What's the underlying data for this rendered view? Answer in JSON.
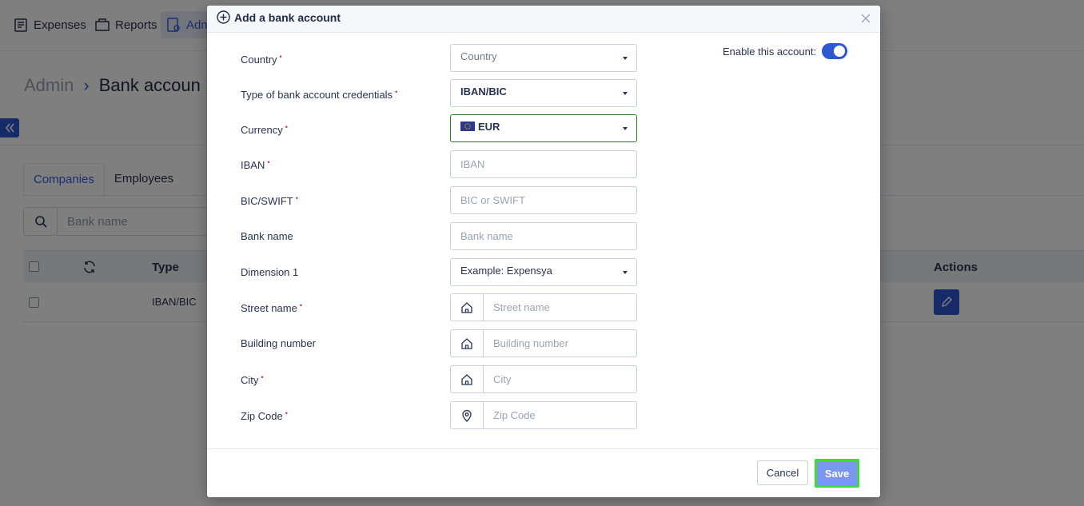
{
  "nav": {
    "expenses": "Expenses",
    "reports": "Reports",
    "admin": "Adm"
  },
  "breadcrumb": {
    "root": "Admin",
    "separator": "›",
    "current": "Bank accoun"
  },
  "tabs": {
    "companies": "Companies",
    "employees": "Employees"
  },
  "search": {
    "placeholder": "Bank name"
  },
  "table": {
    "headers": {
      "type": "Type",
      "actions": "Actions"
    },
    "rows": [
      {
        "type": "IBAN/BIC"
      }
    ]
  },
  "modal": {
    "title": "Add a bank account",
    "enable_label": "Enable this account:",
    "enabled": true,
    "fields": {
      "country": {
        "label": "Country",
        "value": "Country"
      },
      "credentials_type": {
        "label": "Type of bank account credentials",
        "value": "IBAN/BIC"
      },
      "currency": {
        "label": "Currency",
        "value": "EUR"
      },
      "iban": {
        "label": "IBAN",
        "placeholder": "IBAN"
      },
      "bic": {
        "label": "BIC/SWIFT",
        "placeholder": "BIC or SWIFT"
      },
      "bank_name": {
        "label": "Bank name",
        "placeholder": "Bank name"
      },
      "dimension1": {
        "label": "Dimension 1",
        "value": "Example: Expensya"
      },
      "street": {
        "label": "Street name",
        "placeholder": "Street name"
      },
      "building": {
        "label": "Building number",
        "placeholder": "Building number"
      },
      "city": {
        "label": "City",
        "placeholder": "City"
      },
      "zip": {
        "label": "Zip Code",
        "placeholder": "Zip Code"
      }
    },
    "required_mark": "•",
    "cancel": "Cancel",
    "save": "Save"
  },
  "colors": {
    "primary": "#2f57d4",
    "save_button": "#7b96ef",
    "save_highlight": "#3ddc3d",
    "required": "#d63031"
  }
}
